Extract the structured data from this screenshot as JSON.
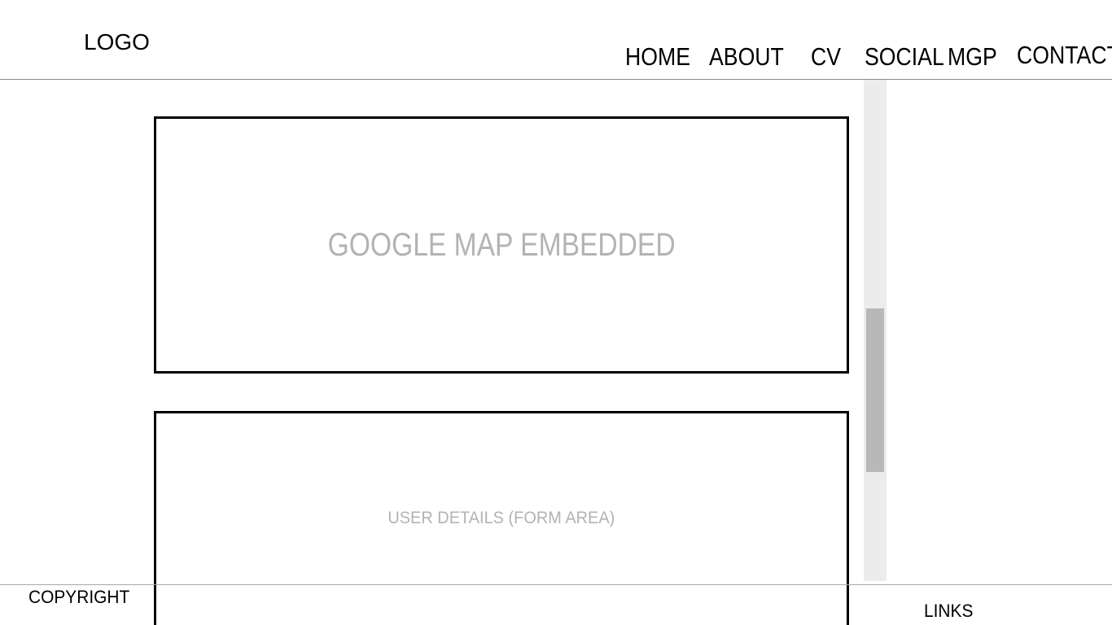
{
  "header": {
    "logo": "LOGO",
    "nav": {
      "home": "HOME",
      "about": "ABOUT",
      "cv": "CV",
      "social": "SOCIAL",
      "mgp": "MGP",
      "contact": "CONTACT"
    }
  },
  "main": {
    "map_placeholder": "GOOGLE MAP EMBEDDED",
    "form_placeholder": "USER DETAILS (FORM AREA)"
  },
  "footer": {
    "copyright": "COPYRIGHT",
    "links": "LINKS"
  },
  "colors": {
    "placeholder_text": "#b3b3b3",
    "scroll_track": "#ececec",
    "scroll_thumb": "#b8b8b8"
  }
}
